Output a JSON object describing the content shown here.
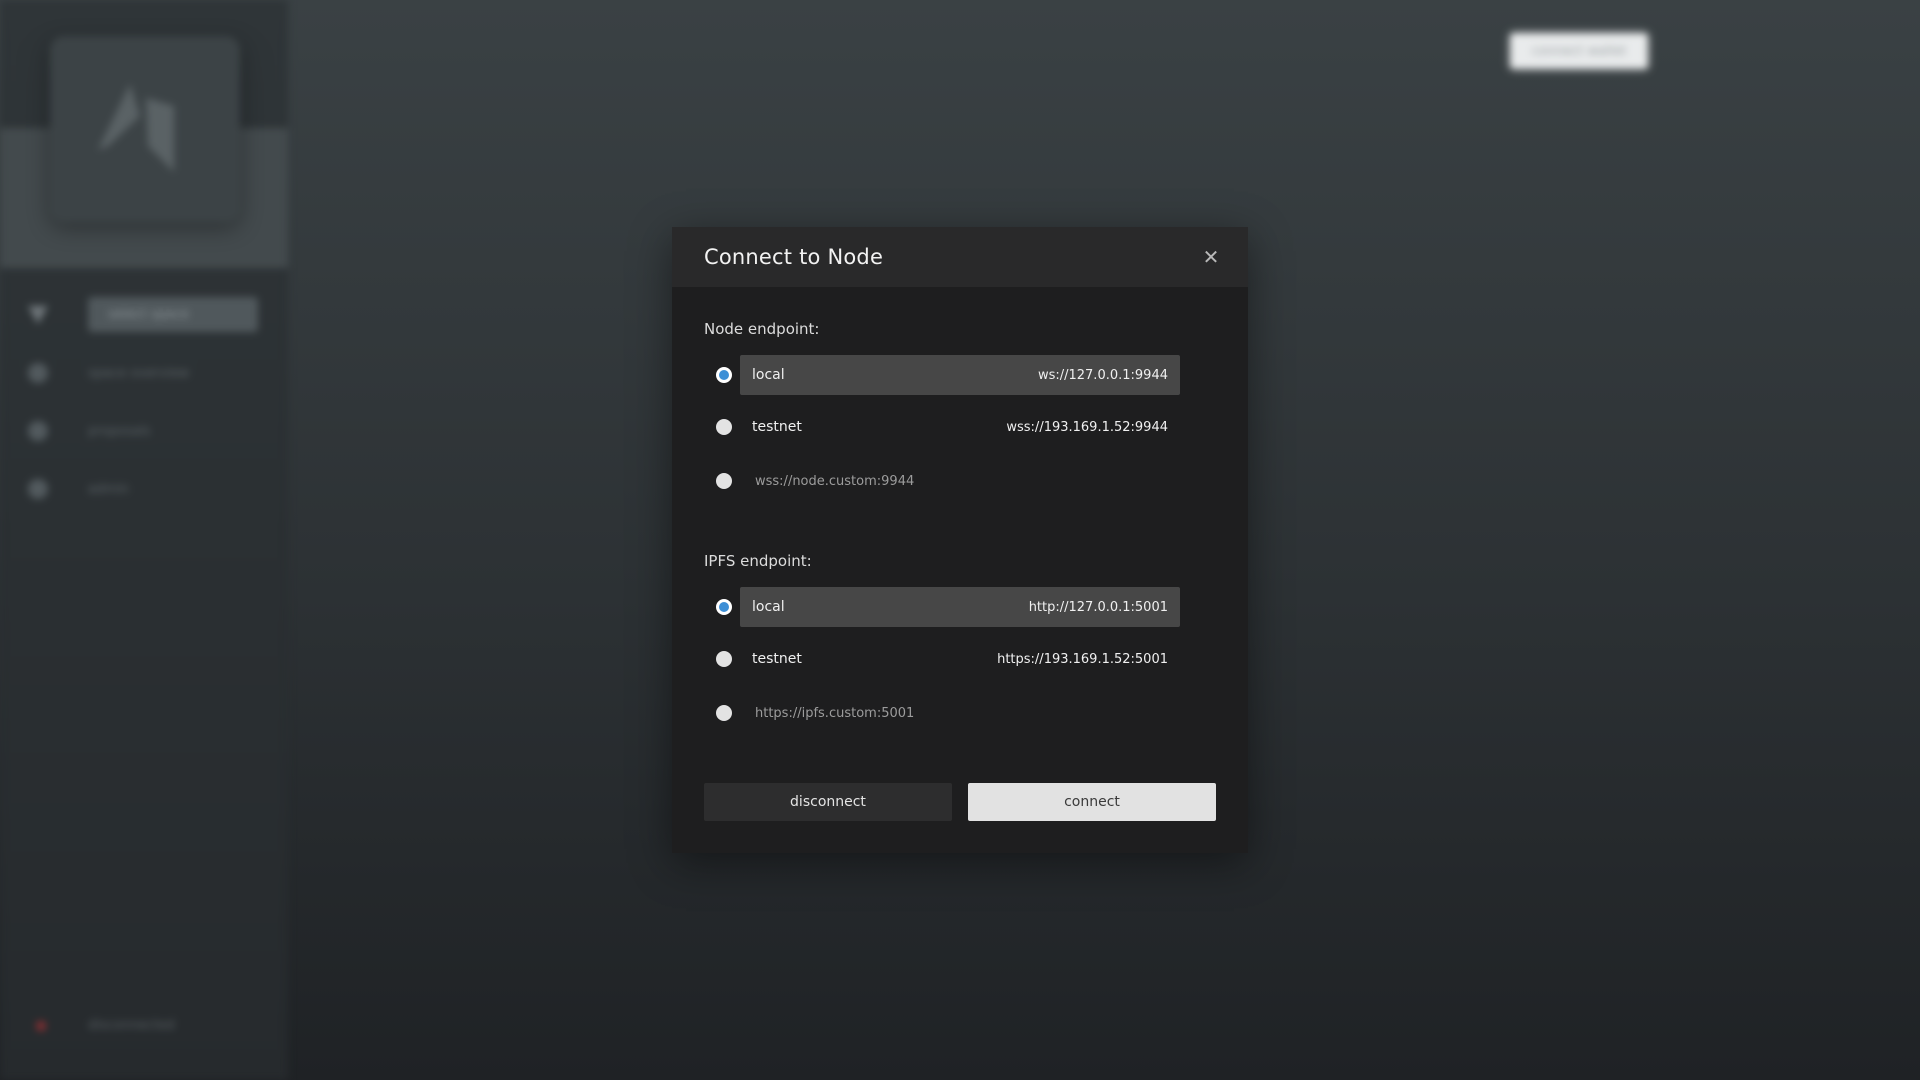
{
  "background": {
    "sidebar": {
      "items": [
        {
          "label": "select space",
          "active": true
        },
        {
          "label": "space overview",
          "active": false
        },
        {
          "label": "proposals",
          "active": false
        },
        {
          "label": "admin",
          "active": false
        }
      ],
      "status": "disconnected"
    },
    "header": {
      "connect_wallet_label": "connect wallet"
    }
  },
  "modal": {
    "title": "Connect to Node",
    "close_icon": "close-icon",
    "node": {
      "label": "Node endpoint:",
      "options": [
        {
          "name": "local",
          "url": "ws://127.0.0.1:9944",
          "selected": true
        },
        {
          "name": "testnet",
          "url": "wss://193.169.1.52:9944",
          "selected": false
        }
      ],
      "custom_placeholder": "wss://node.custom:9944"
    },
    "ipfs": {
      "label": "IPFS endpoint:",
      "options": [
        {
          "name": "local",
          "url": "http://127.0.0.1:5001",
          "selected": true
        },
        {
          "name": "testnet",
          "url": "https://193.169.1.52:5001",
          "selected": false
        }
      ],
      "custom_placeholder": "https://ipfs.custom:5001"
    },
    "buttons": {
      "disconnect": "disconnect",
      "connect": "connect"
    }
  },
  "colors": {
    "accent": "#3d8fd6",
    "modal_bg": "#1e1e1f",
    "selected_row": "#474747"
  }
}
